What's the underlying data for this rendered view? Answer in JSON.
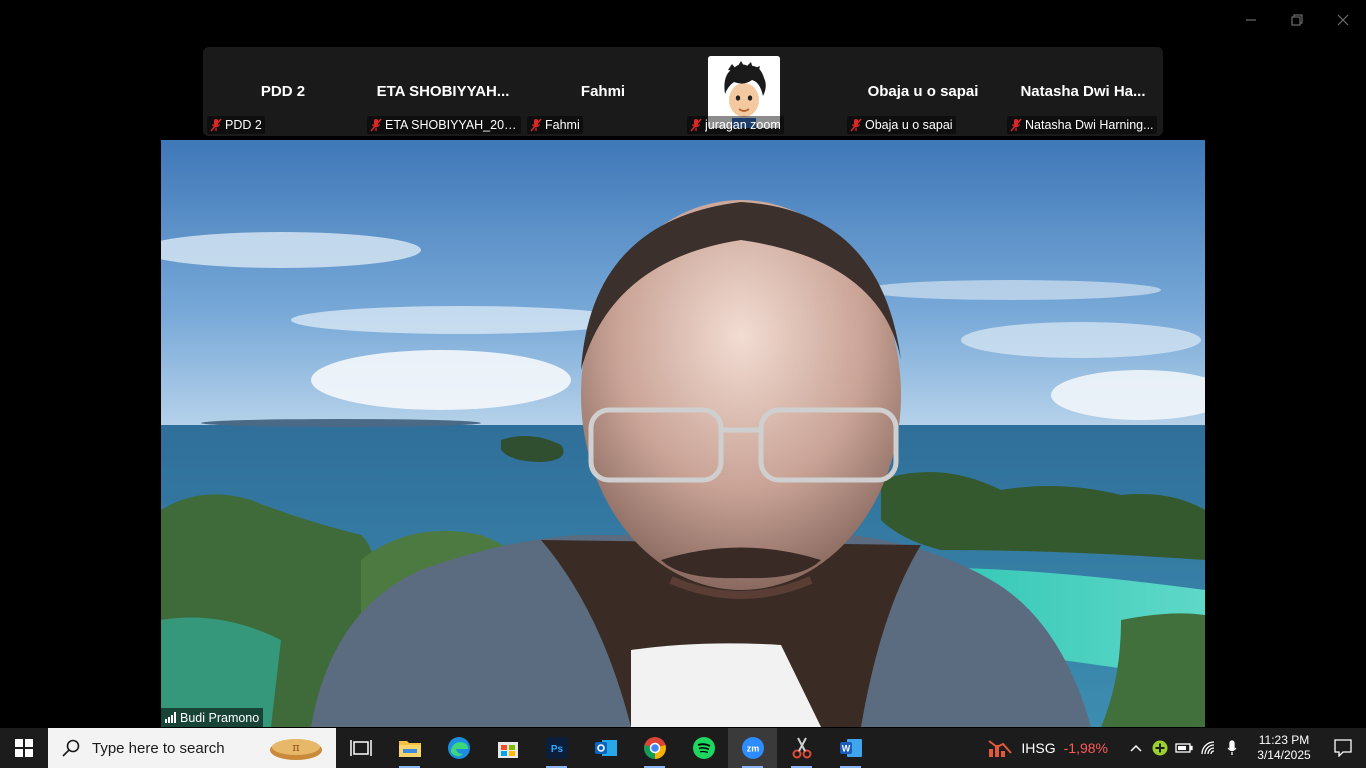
{
  "participants": [
    {
      "display": "PDD 2",
      "label": "PDD 2"
    },
    {
      "display": "ETA  SHOBIYYAH...",
      "label": "ETA SHOBIYYAH_2024..."
    },
    {
      "display": "Fahmi",
      "label": "Fahmi"
    },
    {
      "display": "",
      "label": "juragan zoom"
    },
    {
      "display": "Obaja u o sapai",
      "label": "Obaja u o sapai"
    },
    {
      "display": "Natasha  Dwi  Ha...",
      "label": "Natasha Dwi Harning..."
    }
  ],
  "speaker": {
    "name": "Budi Pramono"
  },
  "taskbar": {
    "search_placeholder": "Type here to search",
    "apps": [
      "task-view",
      "file-explorer",
      "edge",
      "microsoft-store",
      "photoshop",
      "outlook",
      "chrome",
      "spotify",
      "zoom",
      "snipping-tool",
      "word"
    ],
    "active_app": "zoom"
  },
  "ticker": {
    "symbol": "IHSG",
    "change": "-1,98%"
  },
  "clock": {
    "time": "11:23 PM",
    "date": "3/14/2025"
  },
  "colors": {
    "taskbar": "#1c1c1c",
    "strip": "#1a1a1a",
    "negative": "#ff5a5a",
    "mic_off": "#e02828"
  }
}
